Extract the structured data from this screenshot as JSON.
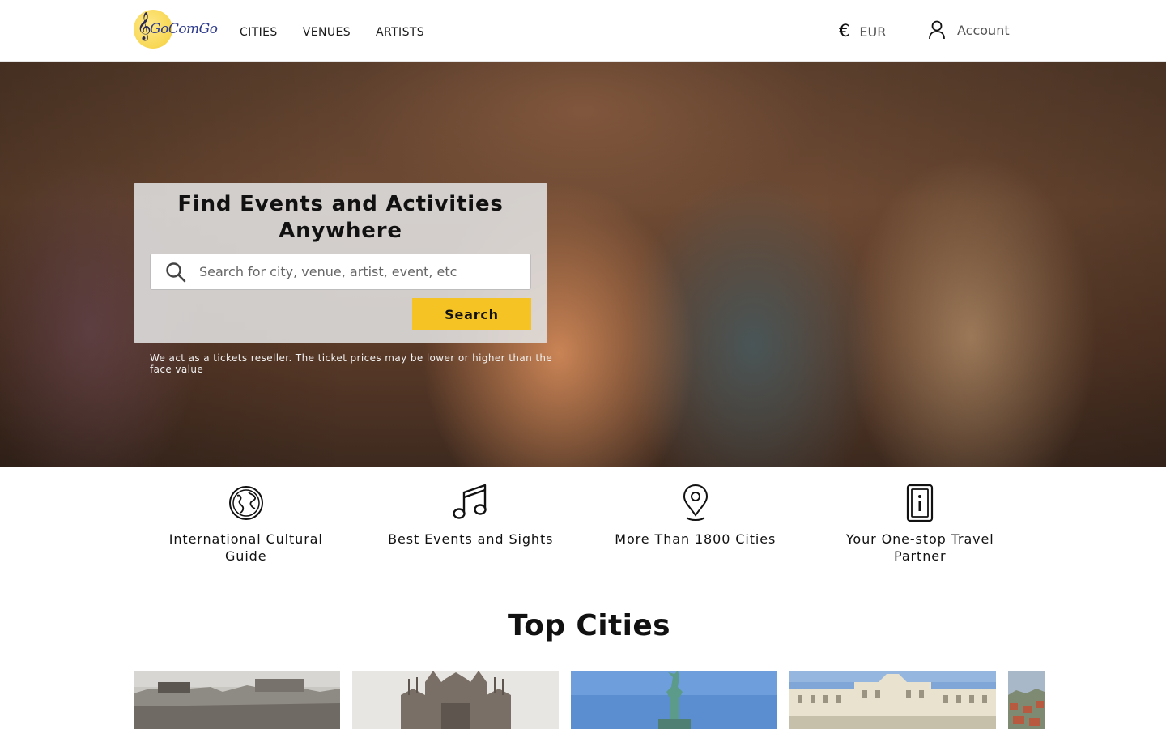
{
  "header": {
    "logo_text": "GoComGo",
    "nav": [
      {
        "label": "CITIES"
      },
      {
        "label": "VENUES"
      },
      {
        "label": "ARTISTS"
      }
    ],
    "currency": {
      "symbol": "€",
      "code": "EUR"
    },
    "account_label": "Account"
  },
  "hero": {
    "title": "Find Events and Activities Anywhere",
    "search_placeholder": "Search for city, venue, artist, event, etc",
    "search_button": "Search",
    "disclaimer": "We act as a tickets reseller. The ticket prices may be lower or higher than the face value"
  },
  "features": [
    {
      "icon": "globe-icon",
      "label": "International Cultural Guide"
    },
    {
      "icon": "music-note-icon",
      "label": "Best Events and Sights"
    },
    {
      "icon": "map-pin-icon",
      "label": "More Than 1800 Cities"
    },
    {
      "icon": "ticket-icon",
      "label": "Your One-stop Travel Partner"
    }
  ],
  "top_cities": {
    "title": "Top Cities"
  },
  "colors": {
    "accent": "#f5c324",
    "text": "#1a1a1a",
    "muted": "#555555"
  }
}
